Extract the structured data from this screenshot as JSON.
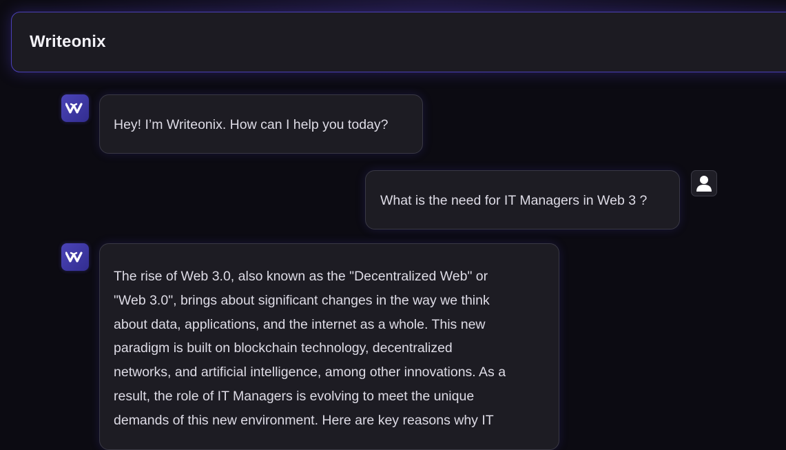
{
  "header": {
    "title": "Writeonix"
  },
  "messages": [
    {
      "role": "assistant",
      "avatar_icon": "writeonix-logo-icon",
      "text": "Hey! I’m Writeonix. How can I help you today?"
    },
    {
      "role": "user",
      "avatar_icon": "user-avatar-icon",
      "text": "What is the need for IT Managers in Web 3 ?"
    },
    {
      "role": "assistant",
      "avatar_icon": "writeonix-logo-icon",
      "lines": [
        "The rise of Web 3.0, also known as the \"Decentralized Web\" or",
        "\"Web 3.0\", brings about significant changes in the way we think",
        "about data, applications, and the internet as a whole. This new",
        "paradigm is built on blockchain technology, decentralized",
        "networks, and artificial intelligence, among other innovations. As a",
        "result, the role of IT Managers is evolving to meet the unique",
        "demands of this new environment. Here are key reasons why IT"
      ]
    }
  ],
  "colors": {
    "background": "#0c0b12",
    "accent": "#4b40b8",
    "bubble": "#1d1c23",
    "bot_avatar": "#4b44b8"
  }
}
